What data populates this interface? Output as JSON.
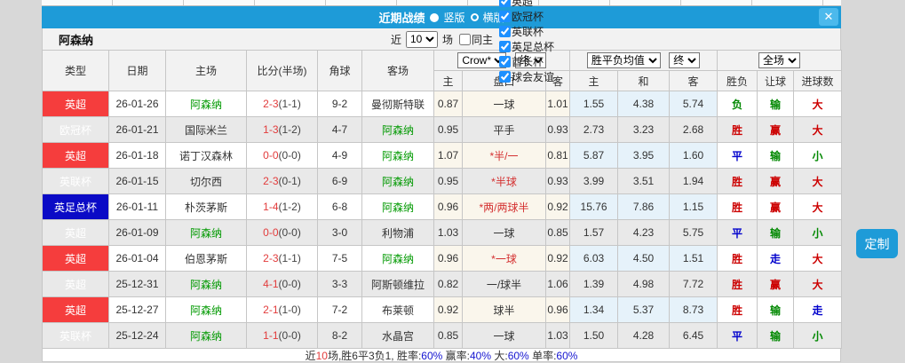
{
  "titlebar": {
    "title": "近期战绩",
    "layout_vertical": "竖版",
    "layout_horizontal": "横版",
    "close_label": "✕"
  },
  "filterbar": {
    "team": "阿森纳",
    "recent_label": "近",
    "recent_count": "10",
    "matches_label": "场",
    "same_home_label": "同主",
    "competitions": [
      {
        "label": "英超",
        "checked": true
      },
      {
        "label": "欧冠杯",
        "checked": true
      },
      {
        "label": "英联杯",
        "checked": true
      },
      {
        "label": "英足总杯",
        "checked": true
      },
      {
        "label": "酋长杯",
        "checked": true
      },
      {
        "label": "球会友谊",
        "checked": true
      }
    ]
  },
  "table": {
    "main_headers": [
      "类型",
      "日期",
      "主场",
      "比分(半场)",
      "角球",
      "客场"
    ],
    "dropdowns": {
      "bookmaker": "Crow*",
      "final_a": "终",
      "wdl_avg": "胜平负均值",
      "final_b": "终",
      "full_match": "全场"
    },
    "sub_headers": [
      "主",
      "盘口",
      "客",
      "主",
      "和",
      "客",
      "胜负",
      "让球",
      "进球数"
    ],
    "rows": [
      {
        "type": "英超",
        "type_color": "red",
        "date": "26-01-26",
        "home": "阿森纳",
        "home_is_team": true,
        "score": "2-3",
        "half_score": "(1-1)",
        "corners": "9-2",
        "away": "曼彻斯特联",
        "away_is_team": false,
        "odds_home": "0.87",
        "handicap": "一球",
        "handicap_changed": false,
        "odds_away": "1.01",
        "avg_win": "1.55",
        "avg_draw": "4.38",
        "avg_lose": "5.74",
        "result_wdl": "负",
        "result_wdl_color": "green",
        "result_handicap": "输",
        "result_handicap_color": "green",
        "result_goals": "大",
        "result_goals_color": "red"
      },
      {
        "type": "欧冠杯",
        "type_color": "orange",
        "date": "26-01-21",
        "home": "国际米兰",
        "home_is_team": false,
        "score": "1-3",
        "half_score": "(1-2)",
        "corners": "4-7",
        "away": "阿森纳",
        "away_is_team": true,
        "odds_home": "0.95",
        "handicap": "平手",
        "handicap_changed": false,
        "odds_away": "0.93",
        "avg_win": "2.73",
        "avg_draw": "3.23",
        "avg_lose": "2.68",
        "result_wdl": "胜",
        "result_wdl_color": "red",
        "result_handicap": "赢",
        "result_handicap_color": "red",
        "result_goals": "大",
        "result_goals_color": "red"
      },
      {
        "type": "英超",
        "type_color": "red",
        "date": "26-01-18",
        "home": "诺丁汉森林",
        "home_is_team": false,
        "score": "0-0",
        "half_score": "(0-0)",
        "corners": "4-9",
        "away": "阿森纳",
        "away_is_team": true,
        "odds_home": "1.07",
        "handicap": "*半/一",
        "handicap_changed": true,
        "odds_away": "0.81",
        "avg_win": "5.87",
        "avg_draw": "3.95",
        "avg_lose": "1.60",
        "result_wdl": "平",
        "result_wdl_color": "blue",
        "result_handicap": "输",
        "result_handicap_color": "green",
        "result_goals": "小",
        "result_goals_color": "green"
      },
      {
        "type": "英联杯",
        "type_color": "gray",
        "date": "26-01-15",
        "home": "切尔西",
        "home_is_team": false,
        "score": "2-3",
        "half_score": "(0-1)",
        "corners": "6-9",
        "away": "阿森纳",
        "away_is_team": true,
        "odds_home": "0.95",
        "handicap": "*半球",
        "handicap_changed": true,
        "odds_away": "0.93",
        "avg_win": "3.99",
        "avg_draw": "3.51",
        "avg_lose": "1.94",
        "result_wdl": "胜",
        "result_wdl_color": "red",
        "result_handicap": "赢",
        "result_handicap_color": "red",
        "result_goals": "大",
        "result_goals_color": "red"
      },
      {
        "type": "英足总杯",
        "type_color": "blue",
        "date": "26-01-11",
        "home": "朴茨茅斯",
        "home_is_team": false,
        "score": "1-4",
        "half_score": "(1-2)",
        "corners": "6-8",
        "away": "阿森纳",
        "away_is_team": true,
        "odds_home": "0.96",
        "handicap": "*两/两球半",
        "handicap_changed": true,
        "odds_away": "0.92",
        "avg_win": "15.76",
        "avg_draw": "7.86",
        "avg_lose": "1.15",
        "result_wdl": "胜",
        "result_wdl_color": "red",
        "result_handicap": "赢",
        "result_handicap_color": "red",
        "result_goals": "大",
        "result_goals_color": "red"
      },
      {
        "type": "英超",
        "type_color": "red",
        "date": "26-01-09",
        "home": "阿森纳",
        "home_is_team": true,
        "score": "0-0",
        "half_score": "(0-0)",
        "corners": "3-0",
        "away": "利物浦",
        "away_is_team": false,
        "odds_home": "1.03",
        "handicap": "一球",
        "handicap_changed": false,
        "odds_away": "0.85",
        "avg_win": "1.57",
        "avg_draw": "4.23",
        "avg_lose": "5.75",
        "result_wdl": "平",
        "result_wdl_color": "blue",
        "result_handicap": "输",
        "result_handicap_color": "green",
        "result_goals": "小",
        "result_goals_color": "green"
      },
      {
        "type": "英超",
        "type_color": "red",
        "date": "26-01-04",
        "home": "伯恩茅斯",
        "home_is_team": false,
        "score": "2-3",
        "half_score": "(1-1)",
        "corners": "7-5",
        "away": "阿森纳",
        "away_is_team": true,
        "odds_home": "0.96",
        "handicap": "*一球",
        "handicap_changed": true,
        "odds_away": "0.92",
        "avg_win": "6.03",
        "avg_draw": "4.50",
        "avg_lose": "1.51",
        "result_wdl": "胜",
        "result_wdl_color": "red",
        "result_handicap": "走",
        "result_handicap_color": "blue",
        "result_goals": "大",
        "result_goals_color": "red"
      },
      {
        "type": "英超",
        "type_color": "red",
        "date": "25-12-31",
        "home": "阿森纳",
        "home_is_team": true,
        "score": "4-1",
        "half_score": "(0-0)",
        "corners": "3-3",
        "away": "阿斯顿维拉",
        "away_is_team": false,
        "odds_home": "0.82",
        "handicap": "一/球半",
        "handicap_changed": false,
        "odds_away": "1.06",
        "avg_win": "1.39",
        "avg_draw": "4.98",
        "avg_lose": "7.72",
        "result_wdl": "胜",
        "result_wdl_color": "red",
        "result_handicap": "赢",
        "result_handicap_color": "red",
        "result_goals": "大",
        "result_goals_color": "red"
      },
      {
        "type": "英超",
        "type_color": "red",
        "date": "25-12-27",
        "home": "阿森纳",
        "home_is_team": true,
        "score": "2-1",
        "half_score": "(1-0)",
        "corners": "7-2",
        "away": "布莱顿",
        "away_is_team": false,
        "odds_home": "0.92",
        "handicap": "球半",
        "handicap_changed": false,
        "odds_away": "0.96",
        "avg_win": "1.34",
        "avg_draw": "5.37",
        "avg_lose": "8.73",
        "result_wdl": "胜",
        "result_wdl_color": "red",
        "result_handicap": "输",
        "result_handicap_color": "green",
        "result_goals": "走",
        "result_goals_color": "blue"
      },
      {
        "type": "英联杯",
        "type_color": "gray",
        "date": "25-12-24",
        "home": "阿森纳",
        "home_is_team": true,
        "score": "1-1",
        "half_score": "(0-0)",
        "corners": "8-2",
        "away": "水晶宫",
        "away_is_team": false,
        "odds_home": "0.85",
        "handicap": "一球",
        "handicap_changed": false,
        "odds_away": "1.03",
        "avg_win": "1.50",
        "avg_draw": "4.28",
        "avg_lose": "6.45",
        "result_wdl": "平",
        "result_wdl_color": "blue",
        "result_handicap": "输",
        "result_handicap_color": "green",
        "result_goals": "小",
        "result_goals_color": "green"
      }
    ]
  },
  "footer": {
    "segments": [
      {
        "text": "近",
        "color": "black"
      },
      {
        "text": "10",
        "color": "red"
      },
      {
        "text": "场,胜6平3负1, 胜率:",
        "color": "black"
      },
      {
        "text": "60%",
        "color": "blue"
      },
      {
        "text": " 赢率:",
        "color": "black"
      },
      {
        "text": "40%",
        "color": "blue"
      },
      {
        "text": " 大:",
        "color": "black"
      },
      {
        "text": "60%",
        "color": "blue"
      },
      {
        "text": " 单率:",
        "color": "black"
      },
      {
        "text": "60%",
        "color": "blue"
      }
    ]
  },
  "custom_button": {
    "label": "定制"
  },
  "colors": {
    "accent": "#1e9bd8",
    "badge_red": "#f53d3d",
    "badge_orange": "#ff6a00",
    "badge_gray": "#7f7f7f",
    "badge_blue": "#0a0ac6",
    "team_green": "#009900",
    "score_red": "#e23b3b",
    "result_red": "#cc0000",
    "result_green": "#008800",
    "result_blue": "#0000cc",
    "odds_column_bg": "#faf6ec",
    "avg_column_bg": "#e6f2fa"
  }
}
